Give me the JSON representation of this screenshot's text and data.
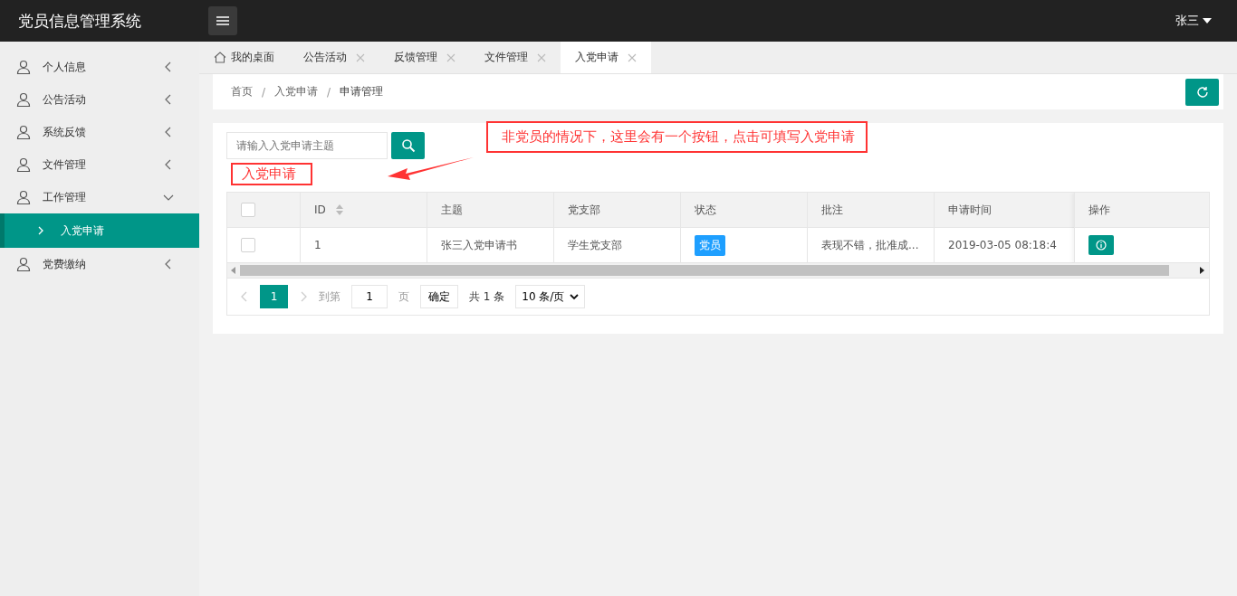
{
  "header": {
    "title": "党员信息管理系统",
    "user": "张三"
  },
  "sidebar": {
    "items": [
      {
        "label": "个人信息",
        "expanded": false
      },
      {
        "label": "公告活动",
        "expanded": false
      },
      {
        "label": "系统反馈",
        "expanded": false
      },
      {
        "label": "文件管理",
        "expanded": false
      },
      {
        "label": "工作管理",
        "expanded": true,
        "children": [
          {
            "label": "入党申请",
            "selected": true
          }
        ]
      },
      {
        "label": "党费缴纳",
        "expanded": false
      }
    ]
  },
  "tabs": [
    {
      "label": "我的桌面",
      "kind": "home",
      "selected": false
    },
    {
      "label": "公告活动",
      "kind": "page",
      "selected": false
    },
    {
      "label": "反馈管理",
      "kind": "page",
      "selected": false
    },
    {
      "label": "文件管理",
      "kind": "page",
      "selected": false
    },
    {
      "label": "入党申请",
      "kind": "page",
      "selected": true
    }
  ],
  "breadcrumb": {
    "separator": "/",
    "items": [
      "首页",
      "入党申请",
      "申请管理"
    ]
  },
  "search": {
    "placeholder": "请输入入党申请主题"
  },
  "annotations": {
    "note": "非党员的情况下，这里会有一个按钮，点击可填写入党申请",
    "marked": "入党申请"
  },
  "table": {
    "header_checked": false,
    "columns": [
      "ID",
      "主题",
      "党支部",
      "状态",
      "批注",
      "申请时间",
      "操作"
    ],
    "rows": [
      {
        "checked": false,
        "id": "1",
        "subject": "张三入党申请书",
        "branch": "学生党支部",
        "status": "党员",
        "note": "表现不错，批准成...",
        "time": "2019-03-05 08:18:4"
      }
    ]
  },
  "pagination": {
    "pages": [
      {
        "label": "1",
        "selected": true
      }
    ],
    "goto_label": "到第",
    "goto_value": "1",
    "page_label": "页",
    "confirm": "确定",
    "total": "共 1 条",
    "page_size": "10 条/页"
  }
}
